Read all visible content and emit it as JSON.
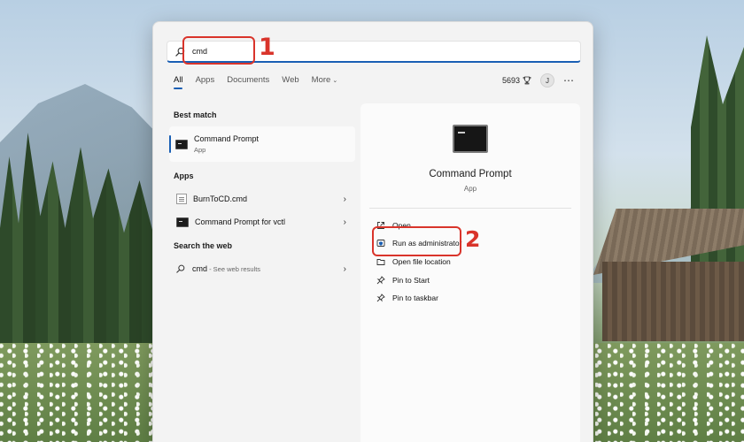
{
  "search": {
    "value": "cmd"
  },
  "tabs": [
    {
      "label": "All",
      "active": true
    },
    {
      "label": "Apps"
    },
    {
      "label": "Documents"
    },
    {
      "label": "Web"
    },
    {
      "label": "More"
    }
  ],
  "header": {
    "points": "5693",
    "avatar_initial": "J"
  },
  "best_match": {
    "title": "Best match",
    "item": {
      "name": "Command Prompt",
      "type": "App"
    }
  },
  "apps": {
    "title": "Apps",
    "items": [
      {
        "name": "BurnToCD.cmd"
      },
      {
        "name": "Command Prompt for vctl"
      }
    ]
  },
  "web": {
    "title": "Search the web",
    "item": {
      "query": "cmd",
      "suffix": " - See web results"
    }
  },
  "preview": {
    "title": "Command Prompt",
    "subtitle": "App",
    "actions": [
      {
        "label": "Open"
      },
      {
        "label": "Run as administrator"
      },
      {
        "label": "Open file location"
      },
      {
        "label": "Pin to Start"
      },
      {
        "label": "Pin to taskbar"
      }
    ]
  },
  "annotations": {
    "step1": "1",
    "step2": "2",
    "color": "#d9342b"
  },
  "colors": {
    "accent": "#1a5fb4",
    "panel": "#f3f3f3"
  }
}
